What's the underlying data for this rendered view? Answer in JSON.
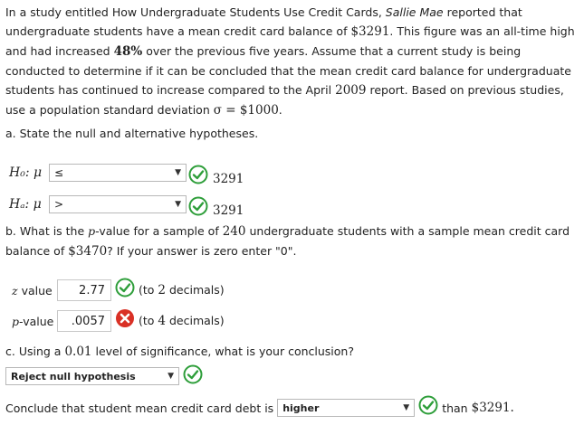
{
  "intro": {
    "p1": "In a study entitled How Undergraduate Students Use Credit Cards,",
    "source": "Sallie Mae",
    "p2": "reported that undergraduate students have a mean credit card balance of",
    "balance": "$3291",
    "p3": ". This figure was an all-time high and had increased",
    "pct": "48%",
    "p4": "over the previous five years. Assume that a current study is being conducted to determine if it can be concluded that the mean credit card balance for undergraduate students has continued to increase compared to the April",
    "year": "2009",
    "p5": "report. Based on previous studies, use a population standard deviation",
    "sigma": "σ = $1000",
    "p6": "."
  },
  "part_a": {
    "prompt": "a. State the null and alternative hypotheses.",
    "h0": {
      "label": "H₀: μ",
      "selected": "≤",
      "value": "3291",
      "status": "correct"
    },
    "ha": {
      "label": "Hₐ: μ",
      "selected": ">",
      "value": "3291",
      "status": "correct"
    }
  },
  "part_b": {
    "prompt_1": "b. What is the",
    "p_sym": "p",
    "prompt_2": "-value for a sample of",
    "n": "240",
    "prompt_3": "undergraduate students with a sample mean credit card balance of",
    "mean": "$3470",
    "prompt_4": "? If your answer is zero enter \"0\".",
    "z": {
      "label": "z",
      "label_suffix": "value",
      "value": "2.77",
      "hint_pre": "(to",
      "hint_num": "2",
      "hint_post": "decimals)",
      "status": "correct"
    },
    "p": {
      "label": "p",
      "label_suffix": "-value",
      "value": ".0057",
      "hint_pre": "(to",
      "hint_num": "4",
      "hint_post": "decimals)",
      "status": "incorrect"
    }
  },
  "part_c": {
    "prompt_1": "c. Using a",
    "alpha": "0.01",
    "prompt_2": "level of significance, what is your conclusion?",
    "decision": {
      "selected": "Reject null hypothesis",
      "status": "correct"
    },
    "conclude_pre": "Conclude that student mean credit card debt is",
    "conclusion": {
      "selected": "higher",
      "status": "correct"
    },
    "conclude_post": "than",
    "amount": "$3291."
  },
  "colors": {
    "correct": "#2e9e3a",
    "incorrect": "#d93025"
  }
}
